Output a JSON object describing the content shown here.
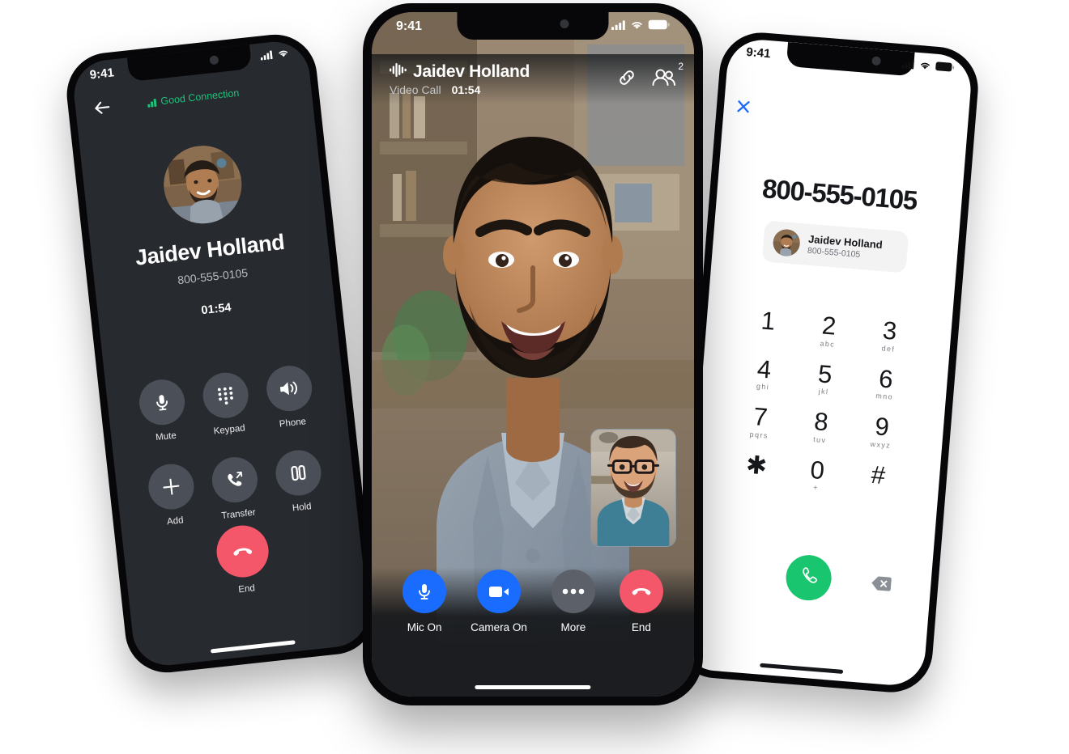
{
  "colors": {
    "dark_bg": "#272a2f",
    "mid_bg": "#1b1d20",
    "blue": "#1a6cff",
    "red": "#f4566a",
    "green": "#19c56e",
    "connection_green": "#1ec27a",
    "control_gray": "#4b5058",
    "more_gray": "#5c6069",
    "card_gray": "#f3f3f4"
  },
  "left_phone": {
    "status": {
      "time": "9:41",
      "cellular": "signal-bars-icon",
      "wifi": "wifi-icon"
    },
    "back_label": "back-arrow-icon",
    "connection": {
      "icon": "signal-bars-icon",
      "label": "Good Connection"
    },
    "avatar": "contact-avatar",
    "name": "Jaidev Holland",
    "number": "800-555-0105",
    "timer": "01:54",
    "controls": [
      {
        "icon": "microphone-icon",
        "label": "Mute"
      },
      {
        "icon": "keypad-dots-icon",
        "label": "Keypad"
      },
      {
        "icon": "speaker-icon",
        "label": "Phone"
      },
      {
        "icon": "plus-icon",
        "label": "Add"
      },
      {
        "icon": "transfer-call-icon",
        "label": "Transfer"
      },
      {
        "icon": "pause-icon",
        "label": "Hold"
      }
    ],
    "end": {
      "icon": "end-call-icon",
      "label": "End"
    }
  },
  "mid_phone": {
    "status": {
      "time": "9:41",
      "cellular": "signal-bars-icon",
      "wifi": "wifi-icon",
      "battery": "battery-icon"
    },
    "header": {
      "waveform_icon": "audio-waveform-icon",
      "name": "Jaidev Holland",
      "call_type": "Video Call",
      "duration": "01:54",
      "link_icon": "link-icon",
      "participants_icon": "participants-icon",
      "participants_count": "2"
    },
    "pip_label": "self-view-video",
    "controls": [
      {
        "icon": "microphone-icon",
        "label": "Mic On",
        "color": "#1a6cff"
      },
      {
        "icon": "video-camera-icon",
        "label": "Camera On",
        "color": "#1a6cff"
      },
      {
        "icon": "more-dots-icon",
        "label": "More",
        "color": "#5c6069"
      },
      {
        "icon": "end-call-icon",
        "label": "End",
        "color": "#f4566a"
      }
    ]
  },
  "right_phone": {
    "status": {
      "time": "9:41",
      "cellular": "signal-bars-icon",
      "wifi": "wifi-icon",
      "battery": "battery-icon"
    },
    "close_icon": "close-x-icon",
    "dialed_number": "800-555-0105",
    "contact_card": {
      "avatar": "contact-avatar",
      "name": "Jaidev Holland",
      "number": "800-555-0105"
    },
    "keypad": [
      {
        "digit": "1",
        "sub": ""
      },
      {
        "digit": "2",
        "sub": "abc"
      },
      {
        "digit": "3",
        "sub": "def"
      },
      {
        "digit": "4",
        "sub": "ghi"
      },
      {
        "digit": "5",
        "sub": "jkl"
      },
      {
        "digit": "6",
        "sub": "mno"
      },
      {
        "digit": "7",
        "sub": "pqrs"
      },
      {
        "digit": "8",
        "sub": "tuv"
      },
      {
        "digit": "9",
        "sub": "wxyz"
      },
      {
        "digit": "✱",
        "sub": ""
      },
      {
        "digit": "0",
        "sub": "+"
      },
      {
        "digit": "#",
        "sub": ""
      }
    ],
    "call_button_icon": "phone-handset-icon",
    "backspace_icon": "backspace-icon"
  }
}
